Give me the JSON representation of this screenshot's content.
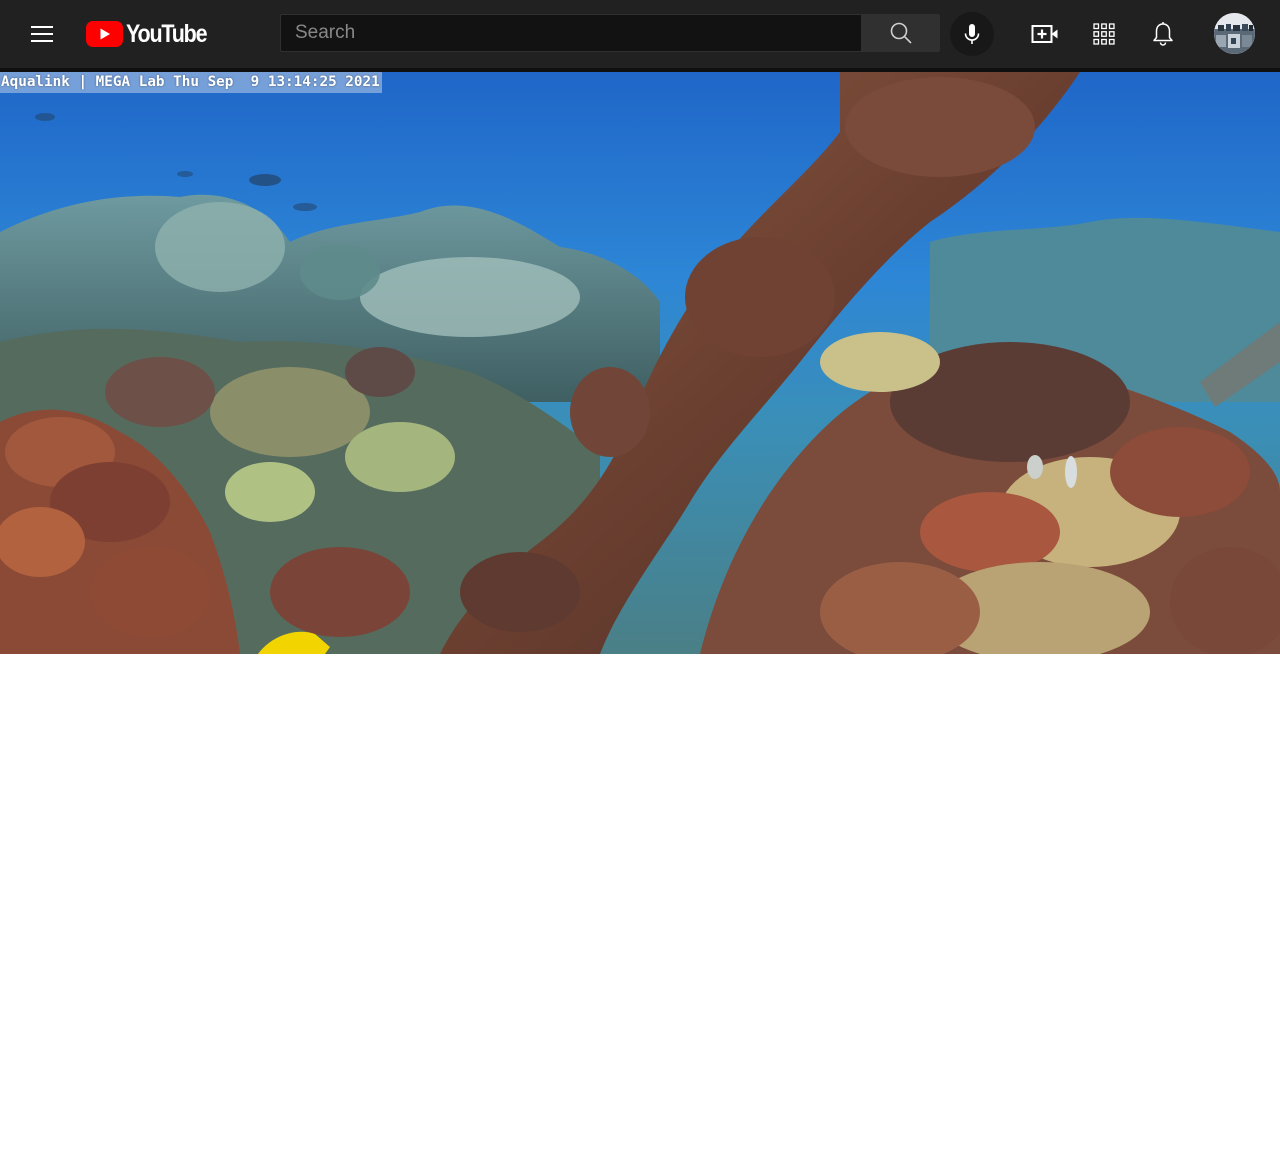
{
  "header": {
    "logo_text": "YouTube",
    "search": {
      "placeholder": "Search",
      "value": ""
    }
  },
  "video": {
    "overlay_text": "Aqualink | MEGA Lab Thu Sep  9 13:14:25 2021"
  },
  "colors": {
    "masthead_bg": "#212121",
    "search_bg": "#121212",
    "search_button_bg": "#303030",
    "brand_red": "#ff0000",
    "page_bg": "#ffffff"
  },
  "icons": [
    "menu-icon",
    "youtube-play-icon",
    "search-icon",
    "microphone-icon",
    "create-video-icon",
    "apps-grid-icon",
    "notifications-bell-icon",
    "avatar-image"
  ]
}
